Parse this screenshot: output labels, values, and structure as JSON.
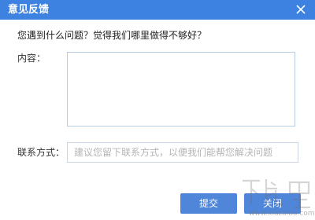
{
  "window": {
    "title": "意见反馈",
    "titlebar_color": "#3d82e0",
    "close_icon": "close-icon"
  },
  "form": {
    "question": "您遇到什么问题？觉得我们哪里做得不够好？",
    "content_label": "内容：",
    "content_value": "",
    "contact_label": "联系方式：",
    "contact_value": "",
    "contact_placeholder": "建议您留下联系方式，以便我们能帮您解决问题"
  },
  "buttons": {
    "submit_label": "提交",
    "close_label": "关闭",
    "button_color": "#4f86d9"
  },
  "watermark": {
    "text": "下载吧",
    "url": "www.xiazaiba.com"
  }
}
